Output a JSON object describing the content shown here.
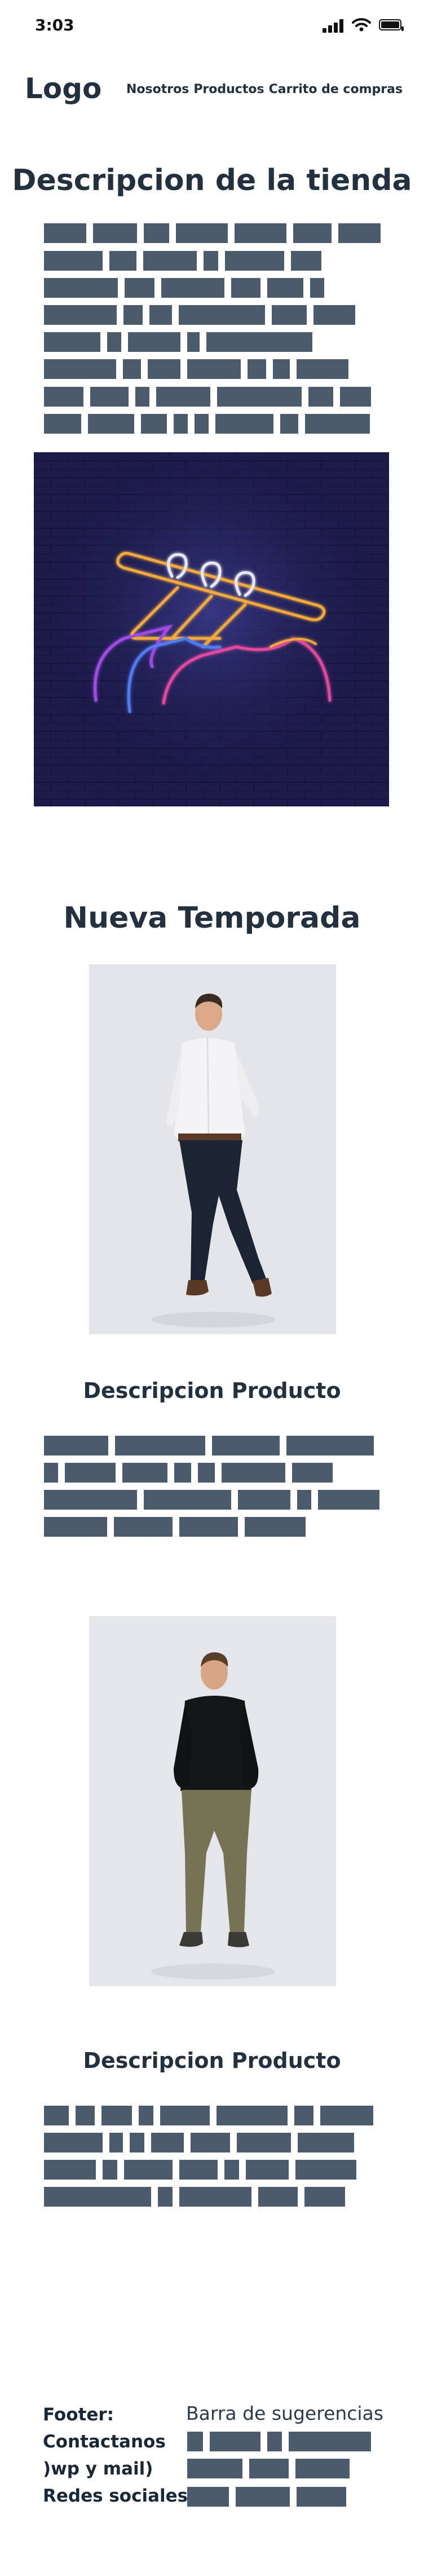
{
  "status_bar": {
    "time": "3:03"
  },
  "header": {
    "logo": "Logo",
    "nav": [
      "Nosotros",
      "Productos",
      "Carrito de compras"
    ]
  },
  "store": {
    "title": "Descripcion de la tienda"
  },
  "season": {
    "title": "Nueva Temporada"
  },
  "products": [
    {
      "title": "Descripcion  Producto"
    },
    {
      "title": "Descripcion Producto"
    }
  ],
  "footer": {
    "lines": [
      "Footer:",
      "Contactanos",
      ")wp y mail)",
      "Redes sociales"
    ],
    "suggestions_title": "Barra de sugerencias"
  },
  "colors": {
    "text": "#23313f",
    "placeholder_bar": "#4b5b6b",
    "neon_background": "#1c1b4a",
    "neon_rail": "#f2a93b",
    "neon_pink": "#e2489c",
    "neon_blue": "#4f7cf2",
    "neon_purple": "#a04ce3"
  },
  "icons": [
    "signal-icon",
    "wifi-icon",
    "battery-icon"
  ]
}
